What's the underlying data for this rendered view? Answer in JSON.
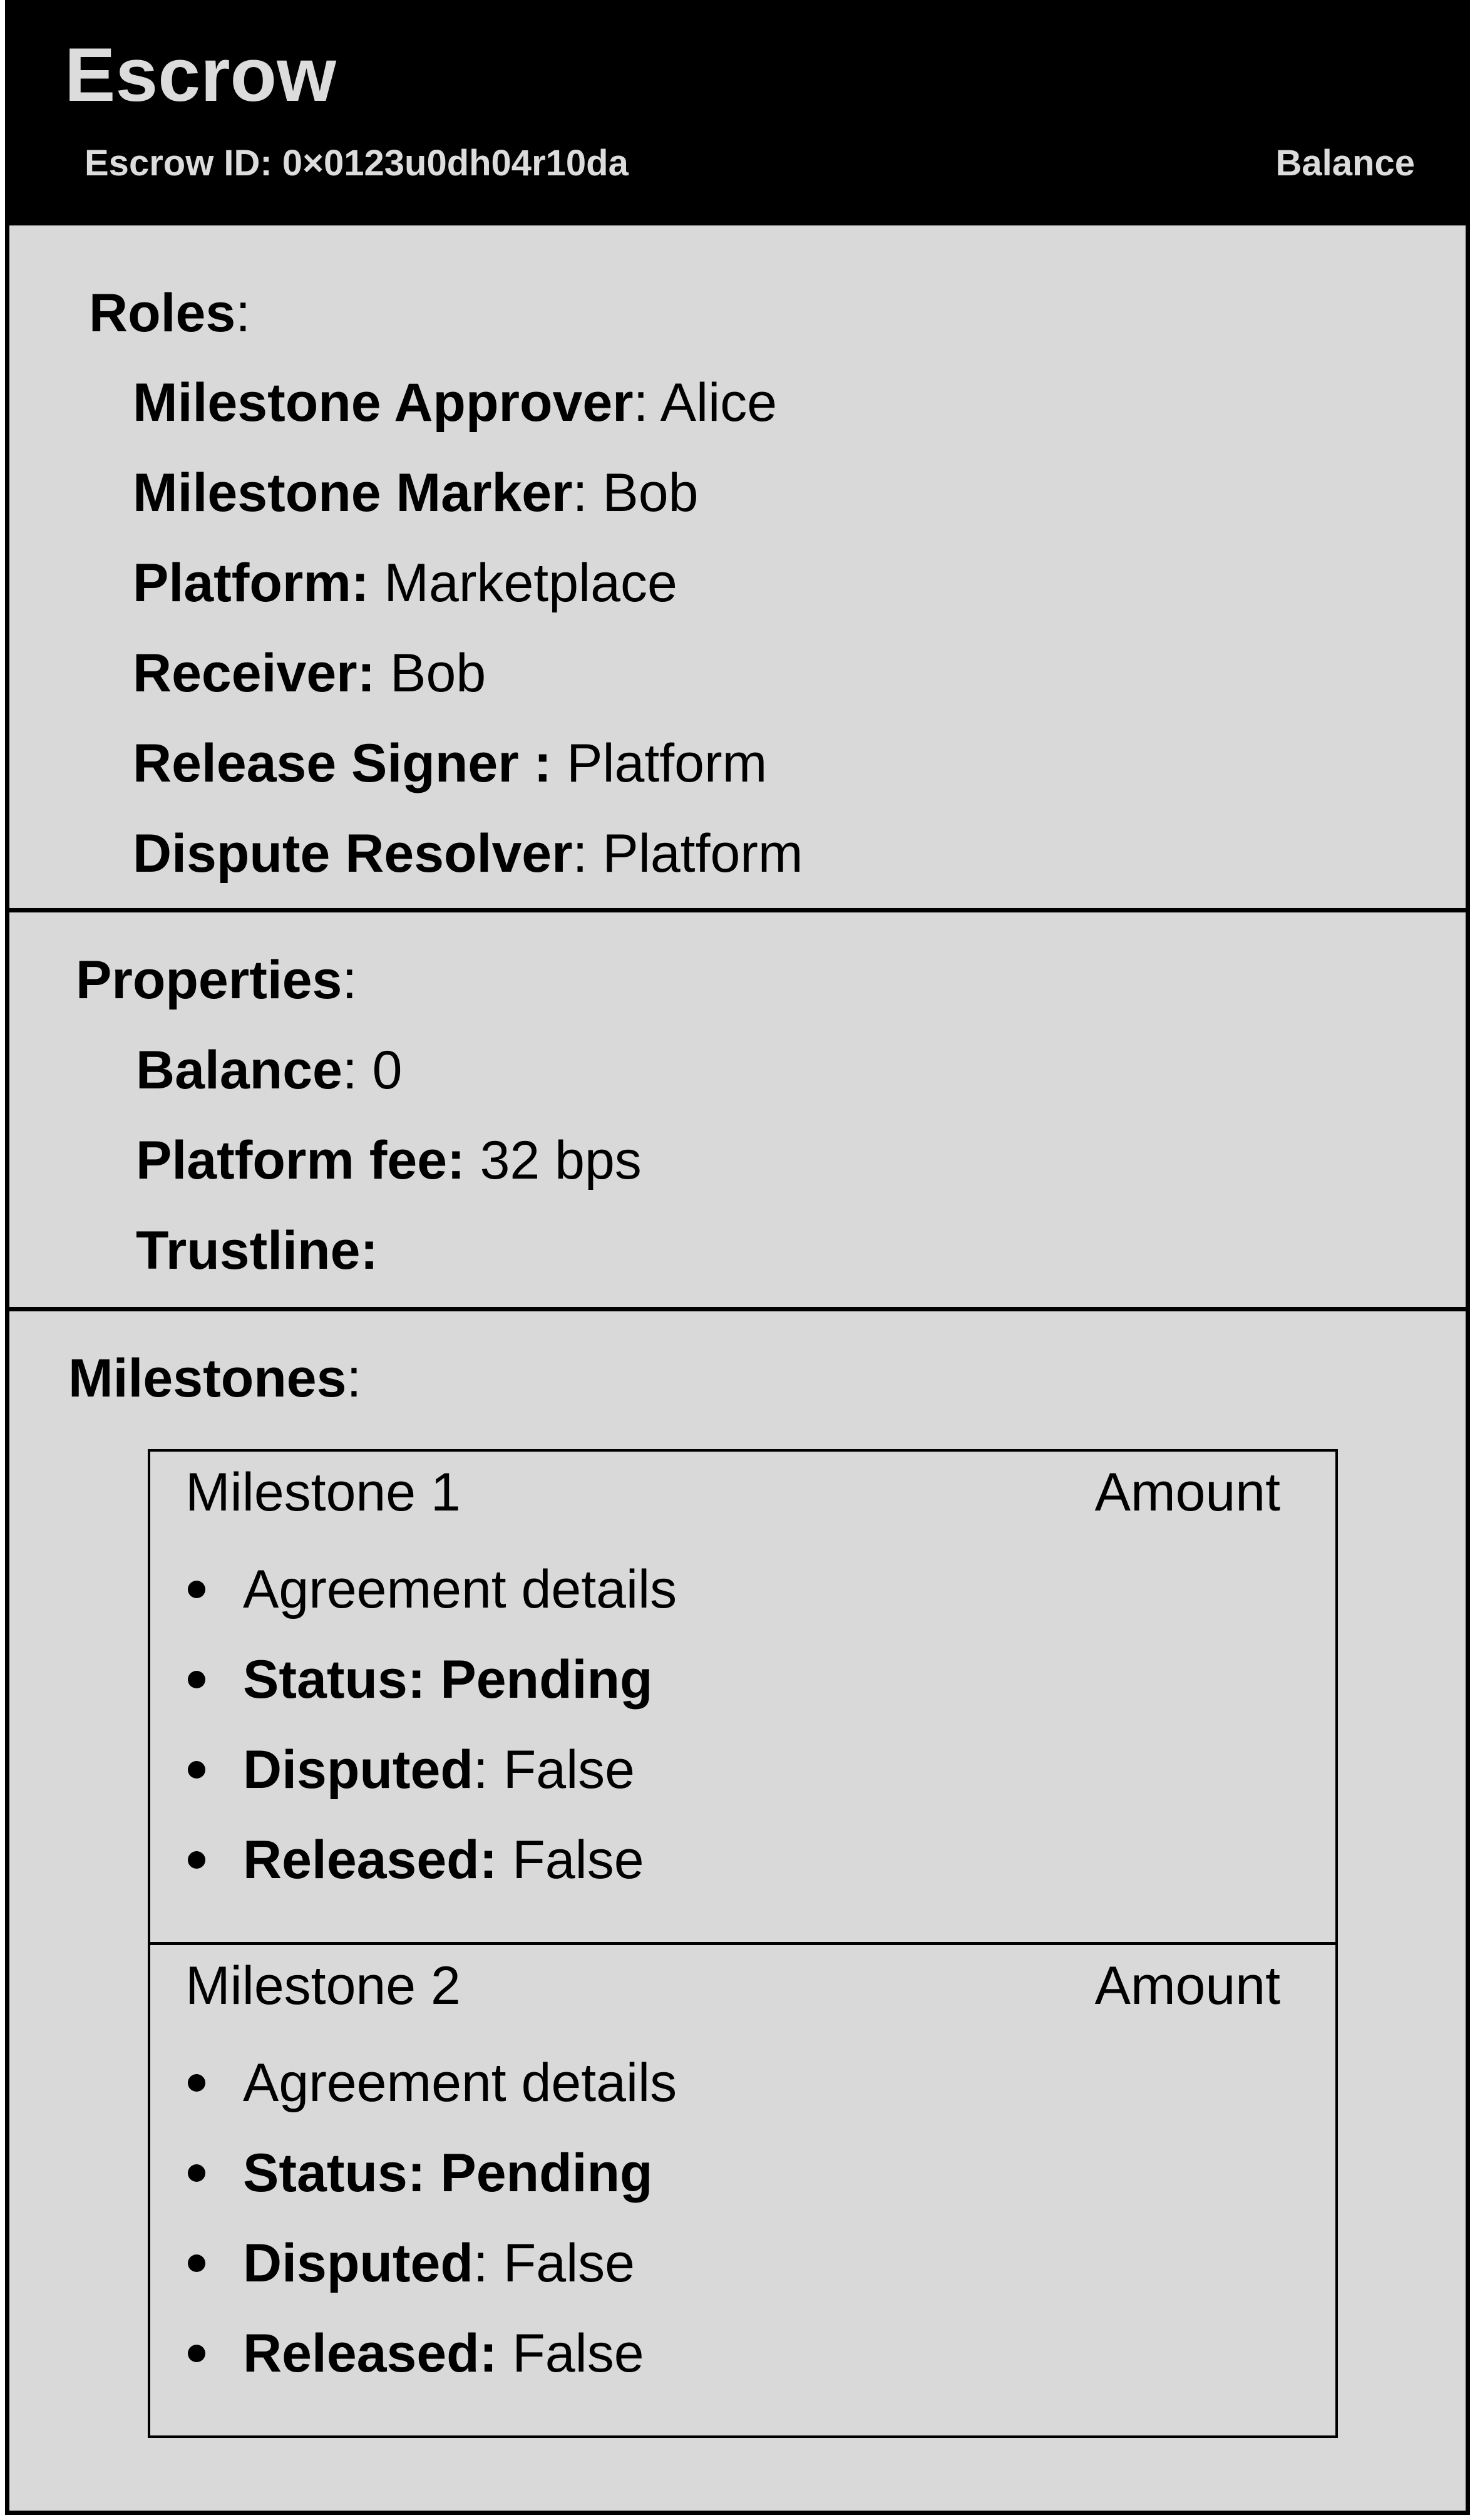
{
  "header": {
    "title": "Escrow",
    "escrow_id": "Escrow ID: 0×0123u0dh04r10da",
    "balance_link": "Balance"
  },
  "roles": {
    "title": "Roles",
    "colon": ":",
    "items": [
      {
        "label": "Milestone Approver",
        "sep": ": ",
        "value": "Alice"
      },
      {
        "label": "Milestone Marker",
        "sep": ": ",
        "value": "Bob"
      },
      {
        "label": "Platform:",
        "sep": " ",
        "value": "Marketplace"
      },
      {
        "label": "Receiver:",
        "sep": " ",
        "value": "Bob"
      },
      {
        "label": "Release Signer :",
        "sep": " ",
        "value": "Platform"
      },
      {
        "label": "Dispute Resolver",
        "sep": ": ",
        "value": "Platform"
      }
    ]
  },
  "properties": {
    "title": "Properties",
    "colon": ":",
    "items": [
      {
        "label": "Balance",
        "sep": ": ",
        "value": "0"
      },
      {
        "label": "Platform fee:",
        "sep": " ",
        "value": "32 bps"
      },
      {
        "label": "Trustline:",
        "sep": "",
        "value": ""
      }
    ]
  },
  "milestones": {
    "title": "Milestones",
    "colon": ":",
    "items": [
      {
        "name": "Milestone 1",
        "amount": "Amount",
        "details": "Agreement details",
        "status": "Status: Pending",
        "disputed_label": "Disputed",
        "disputed_sep": ": ",
        "disputed_value": "False",
        "released_label": "Released:",
        "released_sep": " ",
        "released_value": "False"
      },
      {
        "name": "Milestone 2",
        "amount": "Amount",
        "details": "Agreement details",
        "status": "Status: Pending",
        "disputed_label": "Disputed",
        "disputed_sep": ": ",
        "disputed_value": "False",
        "released_label": "Released:",
        "released_sep": " ",
        "released_value": "False"
      }
    ]
  }
}
